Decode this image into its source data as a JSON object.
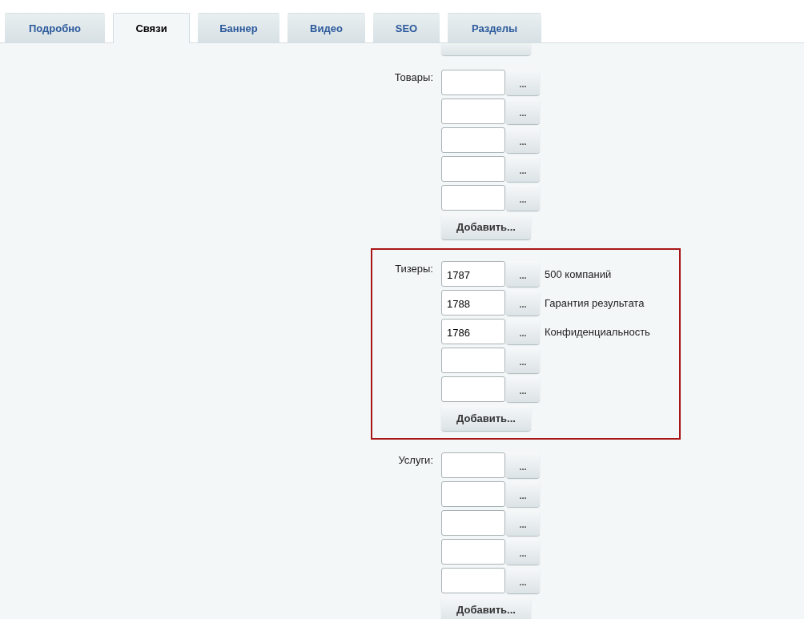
{
  "tabs": [
    {
      "label": "Подробно",
      "selected": false
    },
    {
      "label": "Связи",
      "selected": true
    },
    {
      "label": "Баннер",
      "selected": false
    },
    {
      "label": "Видео",
      "selected": false
    },
    {
      "label": "SEO",
      "selected": false
    },
    {
      "label": "Разделы",
      "selected": false
    }
  ],
  "sections": [
    {
      "label": "Товары:",
      "highlighted": false,
      "items": [
        {
          "kind": "empty"
        },
        {
          "kind": "empty"
        },
        {
          "kind": "empty"
        },
        {
          "kind": "empty"
        },
        {
          "kind": "empty"
        }
      ],
      "add_button": "Добавить...",
      "browse_button": "..."
    },
    {
      "label": "Тизеры:",
      "highlighted": true,
      "items": [
        {
          "kind": "filled",
          "value": "1787",
          "caption": "500 компаний"
        },
        {
          "kind": "filled",
          "value": "1788",
          "caption": "Гарантия результата"
        },
        {
          "kind": "filled",
          "value": "1786",
          "caption": "Конфиденциальность"
        },
        {
          "kind": "empty"
        },
        {
          "kind": "empty"
        }
      ],
      "add_button": "Добавить...",
      "browse_button": "..."
    },
    {
      "label": "Услуги:",
      "highlighted": false,
      "items": [
        {
          "kind": "empty"
        },
        {
          "kind": "empty"
        },
        {
          "kind": "empty"
        },
        {
          "kind": "empty"
        },
        {
          "kind": "empty"
        }
      ],
      "add_button": "Добавить...",
      "browse_button": "..."
    }
  ]
}
